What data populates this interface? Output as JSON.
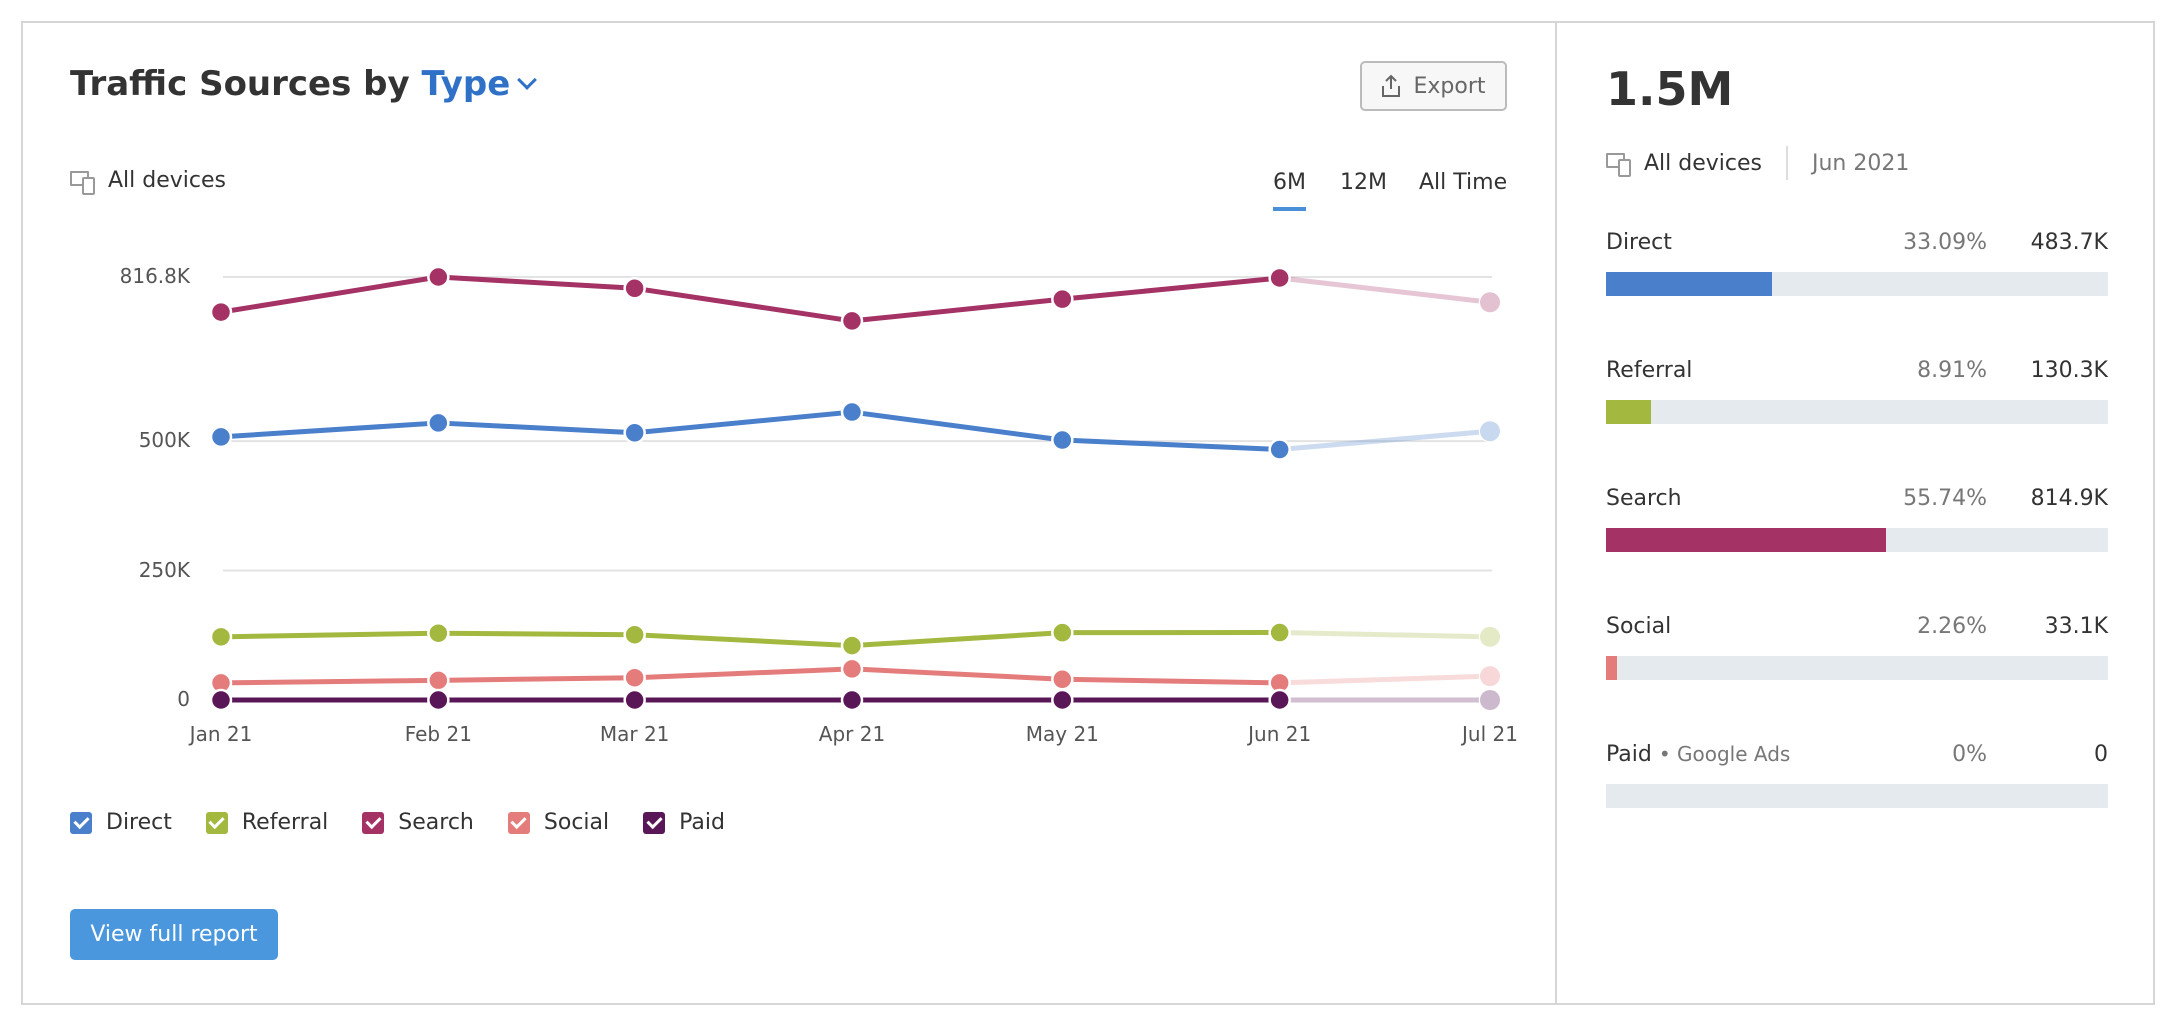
{
  "header": {
    "title_prefix": "Traffic Sources by",
    "title_dropdown": "Type",
    "export_label": "Export",
    "device_filter": "All devices",
    "periods": [
      "6M",
      "12M",
      "All Time"
    ],
    "active_period": "6M"
  },
  "legend": [
    {
      "label": "Direct",
      "checked": true
    },
    {
      "label": "Referral",
      "checked": true
    },
    {
      "label": "Search",
      "checked": true
    },
    {
      "label": "Social",
      "checked": true
    },
    {
      "label": "Paid",
      "checked": true
    }
  ],
  "view_report_label": "View full report",
  "colors": {
    "Direct": "#4a7fcb",
    "Referral": "#a2b83f",
    "Search": "#a43265",
    "Social": "#e57c7c",
    "Paid": "#5a1758",
    "accent": "#4a97dd",
    "bar_track": "#e4eaee"
  },
  "chart_data": {
    "type": "line",
    "x": [
      "2021-01-01",
      "2021-02-01",
      "2021-03-01",
      "2021-04-01",
      "2021-05-01",
      "2021-06-01",
      "2021-07-01"
    ],
    "x_tick_labels": [
      "Jan 21",
      "Feb 21",
      "Mar 21",
      "Apr 21",
      "May 21",
      "Jun 21",
      "Jul 21"
    ],
    "y_unit": "thousands",
    "y_ticks": [
      0,
      250,
      500,
      816.8
    ],
    "y_tick_labels": [
      "0",
      "250K",
      "500K",
      "816.8K"
    ],
    "ylim": [
      0,
      816.8
    ],
    "grid": true,
    "last_point_faded": true,
    "series": [
      {
        "name": "Search",
        "values": [
          749,
          816.8,
          795,
          732,
          774,
          814.9,
          768
        ]
      },
      {
        "name": "Direct",
        "values": [
          508,
          535,
          516,
          556,
          502,
          483.7,
          519
        ]
      },
      {
        "name": "Referral",
        "values": [
          122,
          129,
          126,
          105,
          130,
          130.3,
          122
        ]
      },
      {
        "name": "Social",
        "values": [
          33,
          38,
          43,
          60,
          40,
          33.1,
          46
        ]
      },
      {
        "name": "Paid",
        "values": [
          0,
          0,
          0,
          0,
          0,
          0,
          0
        ]
      }
    ]
  },
  "summary": {
    "total": "1.5M",
    "device_filter": "All devices",
    "date": "Jun 2021",
    "rows": [
      {
        "label": "Direct",
        "sub": "",
        "percent": "33.09%",
        "value": "483.7K",
        "share": 33.09
      },
      {
        "label": "Referral",
        "sub": "",
        "percent": "8.91%",
        "value": "130.3K",
        "share": 8.91
      },
      {
        "label": "Search",
        "sub": "",
        "percent": "55.74%",
        "value": "814.9K",
        "share": 55.74
      },
      {
        "label": "Social",
        "sub": "",
        "percent": "2.26%",
        "value": "33.1K",
        "share": 2.26
      },
      {
        "label": "Paid",
        "sub": "Google Ads",
        "percent": "0%",
        "value": "0",
        "share": 0
      }
    ]
  }
}
